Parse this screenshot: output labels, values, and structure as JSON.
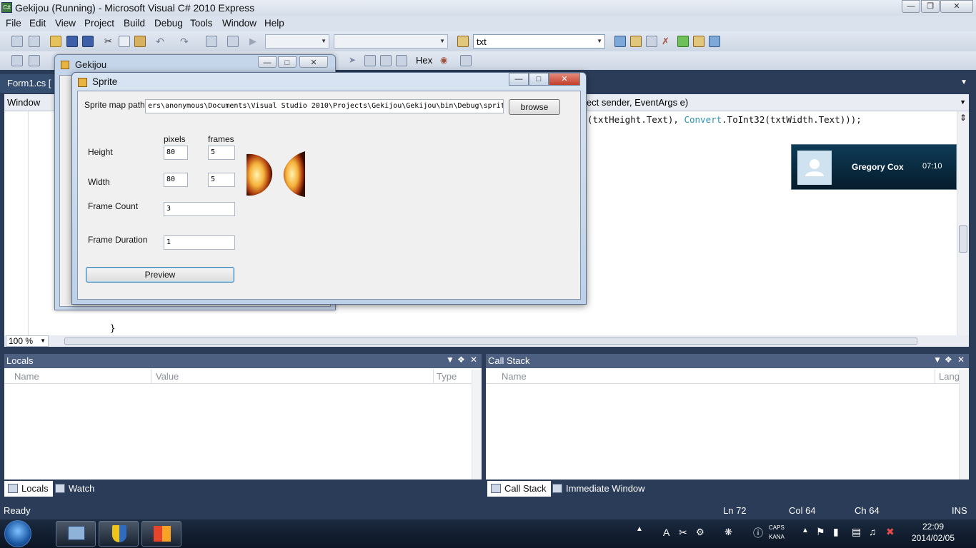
{
  "window": {
    "title": "Gekijou (Running) - Microsoft Visual C# 2010 Express",
    "caption_buttons": [
      "minimize",
      "restore",
      "close"
    ]
  },
  "menubar": {
    "items": [
      "File",
      "Edit",
      "View",
      "Project",
      "Build",
      "Debug",
      "Tools",
      "Window",
      "Help"
    ]
  },
  "toolbar": {
    "find_value": "txt",
    "hex_label": "Hex"
  },
  "doc_tab": {
    "label": "Form1.cs ["
  },
  "navbar": {
    "left": "Window",
    "right": "ject sender, EventArgs e)"
  },
  "editor": {
    "line_part1": "(txtHeight.Text), ",
    "line_kw": "Convert",
    "line_part2": ".ToInt32(txtWidth.Text)));",
    "closing_brace": "}"
  },
  "zoom": {
    "value": "100 %"
  },
  "locals_pane": {
    "title": "Locals",
    "columns": [
      "Name",
      "Value",
      "Type"
    ]
  },
  "callstack_pane": {
    "title": "Call Stack",
    "columns": [
      "Name",
      "Lang"
    ]
  },
  "left_tabs": [
    "Locals",
    "Watch"
  ],
  "right_tabs": [
    "Call Stack",
    "Immediate Window"
  ],
  "statusbar": {
    "state": "Ready",
    "ln": "Ln 72",
    "col": "Col 64",
    "ch": "Ch 64",
    "mode": "INS"
  },
  "gekijou_form": {
    "title": "Gekijou"
  },
  "sprite_form": {
    "title": "Sprite",
    "path_label": "Sprite map path",
    "path_value": "ers\\anonymous\\Documents\\Visual Studio 2010\\Projects\\Gekijou\\Gekijou\\bin\\Debug\\sprite.png",
    "browse_label": "browse",
    "col_pixels": "pixels",
    "col_frames": "frames",
    "height_label": "Height",
    "height_pixels": "80",
    "height_frames": "5",
    "width_label": "Width",
    "width_pixels": "80",
    "width_frames": "5",
    "frame_count_label": "Frame Count",
    "frame_count_value": "3",
    "frame_duration_label": "Frame Duration",
    "frame_duration_value": "1",
    "preview_label": "Preview"
  },
  "notification": {
    "name": "Gregory Cox",
    "time": "07:10"
  },
  "taskbar": {
    "clock_time": "22:09",
    "clock_date": "2014/02/05",
    "caps_label": "CAPS",
    "kana_label": "KANA"
  },
  "colors": {
    "ide_background": "#2b3c59",
    "pane_header": "#4d6082",
    "keyword": "#2b91af"
  }
}
